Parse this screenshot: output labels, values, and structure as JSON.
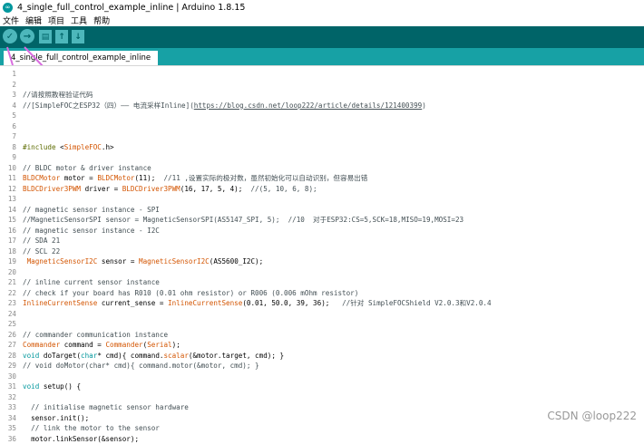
{
  "window": {
    "title": "4_single_full_control_example_inline | Arduino 1.8.15"
  },
  "menu": [
    "文件",
    "编辑",
    "项目",
    "工具",
    "帮助"
  ],
  "toolbar": {
    "verify": "✓",
    "upload": "→",
    "new": "▤",
    "open": "↑",
    "save": "↓"
  },
  "tab": {
    "label": "4_single_full_control_example_inline"
  },
  "watermark": "CSDN @loop222",
  "code": [
    {
      "n": "1",
      "t": ""
    },
    {
      "n": "2",
      "t": ""
    },
    {
      "n": "3",
      "t": "//请按照教程验证代码"
    },
    {
      "n": "4",
      "t": "//[SimpleFOC之ESP32（四）—— 电流采样Inline](https://blog.csdn.net/loop222/article/details/121400399)"
    },
    {
      "n": "5",
      "t": ""
    },
    {
      "n": "6",
      "t": ""
    },
    {
      "n": "7",
      "t": ""
    },
    {
      "n": "8",
      "t": "#include <SimpleFOC.h>"
    },
    {
      "n": "9",
      "t": ""
    },
    {
      "n": "10",
      "t": "// BLDC motor & driver instance"
    },
    {
      "n": "11",
      "t": "BLDCMotor motor = BLDCMotor(11);  //11 ,设置实际的极对数，虽然初始化可以自动识别，但容易出错"
    },
    {
      "n": "12",
      "t": "BLDCDriver3PWM driver = BLDCDriver3PWM(16, 17, 5, 4);  //(5, 10, 6, 8);"
    },
    {
      "n": "13",
      "t": ""
    },
    {
      "n": "14",
      "t": "// magnetic sensor instance - SPI"
    },
    {
      "n": "15",
      "t": "//MagneticSensorSPI sensor = MagneticSensorSPI(AS5147_SPI, 5);  //10  对于ESP32:CS=5,SCK=18,MISO=19,MOSI=23"
    },
    {
      "n": "16",
      "t": "// magnetic sensor instance - I2C"
    },
    {
      "n": "17",
      "t": "// SDA 21"
    },
    {
      "n": "18",
      "t": "// SCL 22"
    },
    {
      "n": "19",
      "t": " MagneticSensorI2C sensor = MagneticSensorI2C(AS5600_I2C);"
    },
    {
      "n": "20",
      "t": ""
    },
    {
      "n": "21",
      "t": "// inline current sensor instance"
    },
    {
      "n": "22",
      "t": "// check if your board has R010 (0.01 ohm resistor) or R006 (0.006 mOhm resistor)"
    },
    {
      "n": "23",
      "t": "InlineCurrentSense current_sense = InlineCurrentSense(0.01, 50.0, 39, 36);   //针对 SimpleFOCShield V2.0.3和V2.0.4"
    },
    {
      "n": "24",
      "t": ""
    },
    {
      "n": "25",
      "t": ""
    },
    {
      "n": "26",
      "t": "// commander communication instance"
    },
    {
      "n": "27",
      "t": "Commander command = Commander(Serial);"
    },
    {
      "n": "28",
      "t": "void doTarget(char* cmd){ command.scalar(&motor.target, cmd); }"
    },
    {
      "n": "29",
      "t": "// void doMotor(char* cmd){ command.motor(&motor, cmd); }"
    },
    {
      "n": "30",
      "t": ""
    },
    {
      "n": "31",
      "t": "void setup() {"
    },
    {
      "n": "32",
      "t": ""
    },
    {
      "n": "33",
      "t": "  // initialise magnetic sensor hardware"
    },
    {
      "n": "34",
      "t": "  sensor.init();"
    },
    {
      "n": "35",
      "t": "  // link the motor to the sensor"
    },
    {
      "n": "36",
      "t": "  motor.linkSensor(&sensor);"
    }
  ]
}
